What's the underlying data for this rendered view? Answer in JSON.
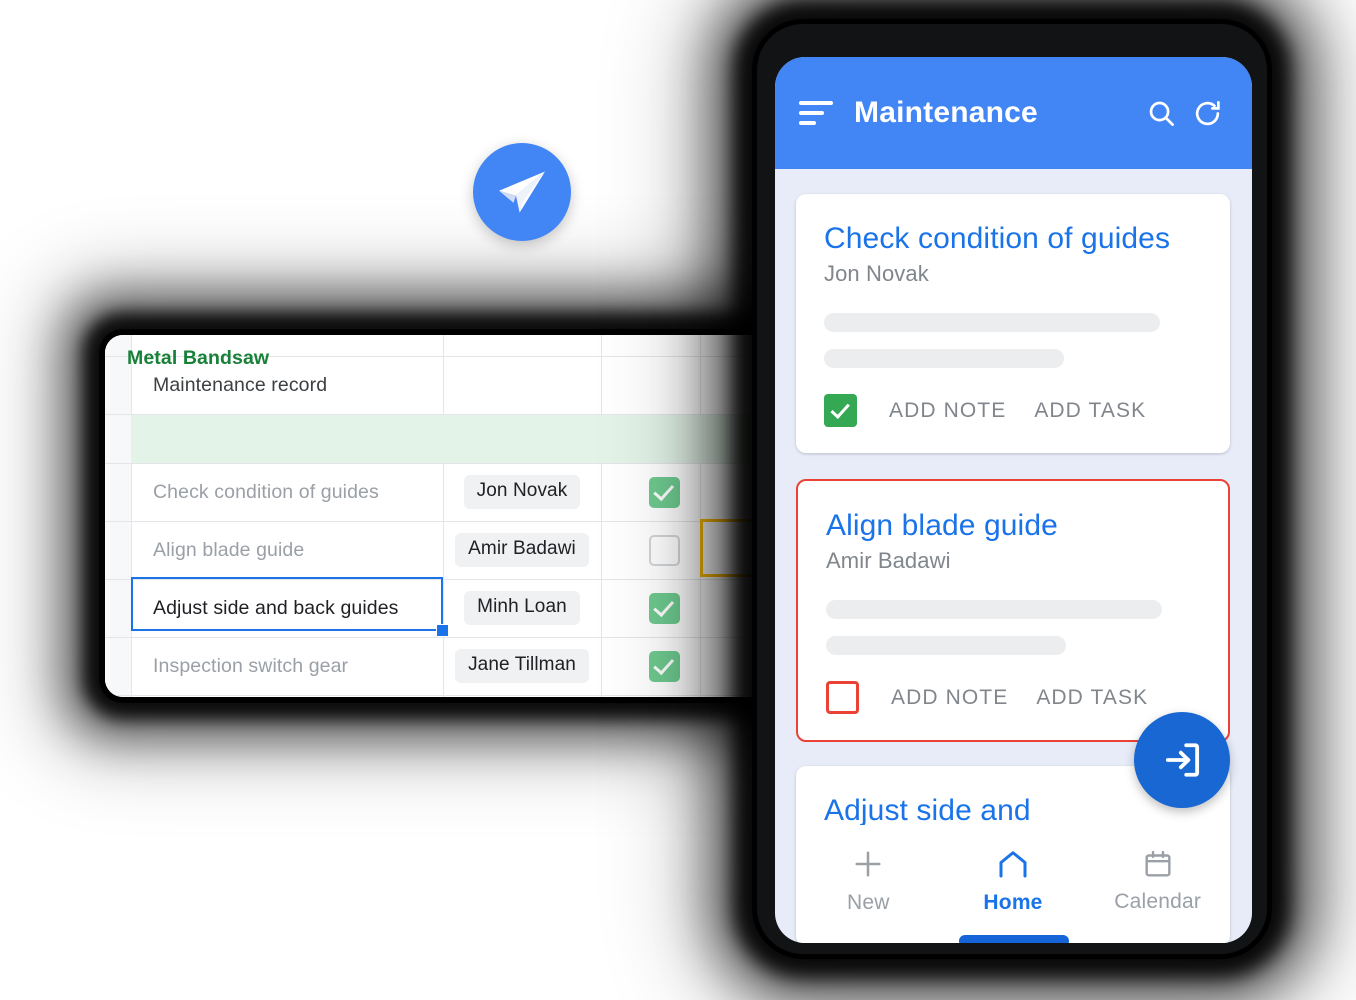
{
  "sheet": {
    "title_row": {
      "label": "Maintenance record"
    },
    "group_row": {
      "label": "Metal Bandsaw"
    },
    "rows": [
      {
        "task": "Check condition of guides",
        "person": "Jon Novak",
        "done": true
      },
      {
        "task": "Align blade guide",
        "person": "Amir Badawi",
        "done": false
      },
      {
        "task": "Adjust side and back guides",
        "person": "Minh Loan",
        "done": true
      },
      {
        "task": "Inspection switch gear",
        "person": "Jane Tillman",
        "done": true
      }
    ],
    "selection": {
      "blue_cell": "Adjust side and back guides",
      "yellow_cell": "Align blade guide checkbox"
    },
    "colors": {
      "group_band_bg": "#E3F3E8",
      "group_text": "#188038",
      "checkbox_green": "#6FCB90",
      "selection_blue": "#1A73E8",
      "selection_yellow": "#FBBC04"
    }
  },
  "plane_badge": {
    "icon": "paper-plane-icon",
    "color": "#4285F4"
  },
  "phone": {
    "appbar": {
      "menu_icon": "sort-icon",
      "title": "Maintenance",
      "search_icon": "search-icon",
      "refresh_icon": "refresh-icon",
      "color": "#4285F4"
    },
    "cards": [
      {
        "title": "Check condition of guides",
        "assignee": "Jon Novak",
        "checked": true,
        "checkbox_state": "checked-green",
        "add_note": "ADD NOTE",
        "add_task": "ADD TASK",
        "border": "none"
      },
      {
        "title": "Align blade guide",
        "assignee": "Amir Badawi",
        "checked": false,
        "checkbox_state": "unchecked-red",
        "add_note": "ADD NOTE",
        "add_task": "ADD TASK",
        "border": "#EA4335"
      },
      {
        "title": "Adjust side and",
        "assignee": "",
        "checked": false,
        "checkbox_state": "hidden",
        "add_note": "",
        "add_task": "",
        "border": "none"
      }
    ],
    "fab": {
      "icon": "login-arrow-icon",
      "color": "#1967D2"
    },
    "bottom_nav": {
      "items": [
        {
          "label": "New",
          "icon": "plus-icon",
          "active": false
        },
        {
          "label": "Home",
          "icon": "home-icon",
          "active": true
        },
        {
          "label": "Calendar",
          "icon": "calendar-icon",
          "active": false
        }
      ],
      "active_color": "#1A73E8",
      "inactive_color": "#9AA0A6"
    }
  }
}
